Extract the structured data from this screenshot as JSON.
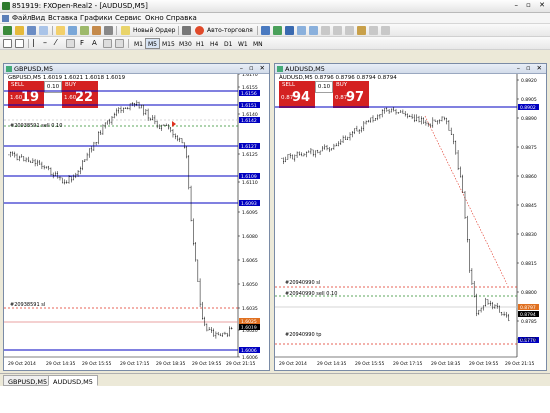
{
  "window": {
    "title": "851919: FXOpen-Real2 - [AUDUSD,M5]",
    "controls": "– ▫ ✕"
  },
  "menu": [
    "Файл",
    "Вид",
    "Вставка",
    "Графики",
    "Сервис",
    "Окно",
    "Справка"
  ],
  "toolbar": {
    "new_order_label": "Новый Ордер",
    "autotrading_label": "Авто-торговля"
  },
  "timeframes": [
    "M1",
    "M5",
    "M15",
    "M30",
    "H1",
    "H4",
    "D1",
    "W1",
    "MN"
  ],
  "active_timeframe": "M5",
  "left_chart": {
    "title": "GBPUSD,M5",
    "ohlc": "GBPUSD,M5 1.6019 1.6021 1.6018 1.6019",
    "sell": {
      "label": "SELL",
      "small": "1.60",
      "big": "19"
    },
    "buy": {
      "label": "BUY",
      "small": "1.60",
      "big": "22"
    },
    "lot": "0.10",
    "order_labels": [
      "#20938591 sell 0.10",
      "#20938591 sl"
    ],
    "price_scale": [
      "1.6170",
      "1.6155",
      "1.6140",
      "1.6125",
      "1.6110",
      "1.6095",
      "1.6080",
      "1.6065",
      "1.6050",
      "1.6035",
      "1.6020",
      "1.6006"
    ],
    "level_tags": [
      "1.6156",
      "1.6151",
      "1.6142",
      "1.6127",
      "1.6109",
      "1.6093",
      "1.6025",
      "1.6019",
      "1.6006"
    ],
    "time_labels": [
      "29 Oct 2014",
      "29 Oct 14:35",
      "29 Oct 15:55",
      "29 Oct 17:15",
      "29 Oct 18:35",
      "29 Oct 19:55",
      "29 Oct 21:15"
    ]
  },
  "right_chart": {
    "title": "AUDUSD,M5",
    "ohlc": "AUDUSD,M5 0.8796 0.8796 0.8794 0.8794",
    "sell": {
      "label": "SELL",
      "small": "0.87",
      "big": "94"
    },
    "buy": {
      "label": "BUY",
      "small": "0.87",
      "big": "97"
    },
    "lot": "0.10",
    "order_labels": [
      "#20940990 sl",
      "#20940990 sell 0.10",
      "#20940990 tp"
    ],
    "price_scale": [
      "0.8920",
      "0.8905",
      "0.8890",
      "0.8875",
      "0.8860",
      "0.8845",
      "0.8830",
      "0.8815",
      "0.8800",
      "0.8785",
      "0.8770"
    ],
    "level_tags": [
      "0.8902",
      "0.8797",
      "0.8794",
      "0.8779"
    ],
    "time_labels": [
      "29 Oct 2014",
      "29 Oct 14:35",
      "29 Oct 15:55",
      "29 Oct 17:15",
      "29 Oct 18:35",
      "29 Oct 19:55",
      "29 Oct 21:15"
    ]
  },
  "tabs": [
    "GBPUSD,M5",
    "AUDUSD,M5"
  ],
  "active_tab": "AUDUSD,M5",
  "colors": {
    "sell_buy": "#d42121",
    "level_line": "#0000c0",
    "order_red": "#e03020",
    "order_green": "#2a8a2a"
  }
}
